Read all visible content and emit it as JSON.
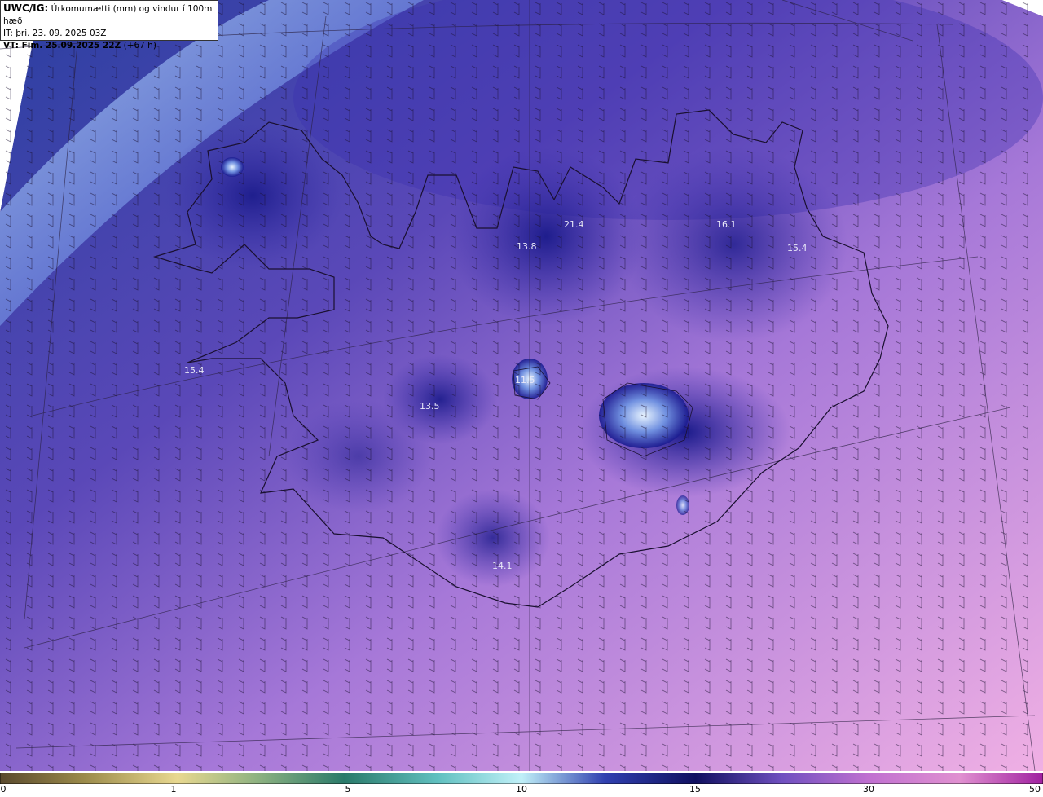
{
  "header": {
    "line1_bold": "UWC/IG:",
    "line1_rest": " Úrkomumætti (mm) og vindur í 100m hæð",
    "line2": "IT: þri. 23. 09. 2025 03Z",
    "line3_bold": "VT: Fim. 25.09.2025 22Z",
    "line3_rest": " (+67 h)"
  },
  "map_labels": [
    {
      "text": "21.4"
    },
    {
      "text": "16.1"
    },
    {
      "text": "15.4"
    },
    {
      "text": "13.8"
    },
    {
      "text": "15.4"
    },
    {
      "text": "11.5"
    },
    {
      "text": "13.5"
    },
    {
      "text": "14.1"
    }
  ],
  "colorbar": {
    "ticks": [
      "0",
      "1",
      "5",
      "10",
      "15",
      "30",
      "50"
    ],
    "colors": [
      "#5a4a2e",
      "#9a8a4a",
      "#e8d890",
      "#8ab080",
      "#2a7a6a",
      "#60c0c0",
      "#c0f0f8",
      "#3040b0",
      "#101060",
      "#7050c0",
      "#c070d0",
      "#e090d0",
      "#a020a0"
    ]
  }
}
